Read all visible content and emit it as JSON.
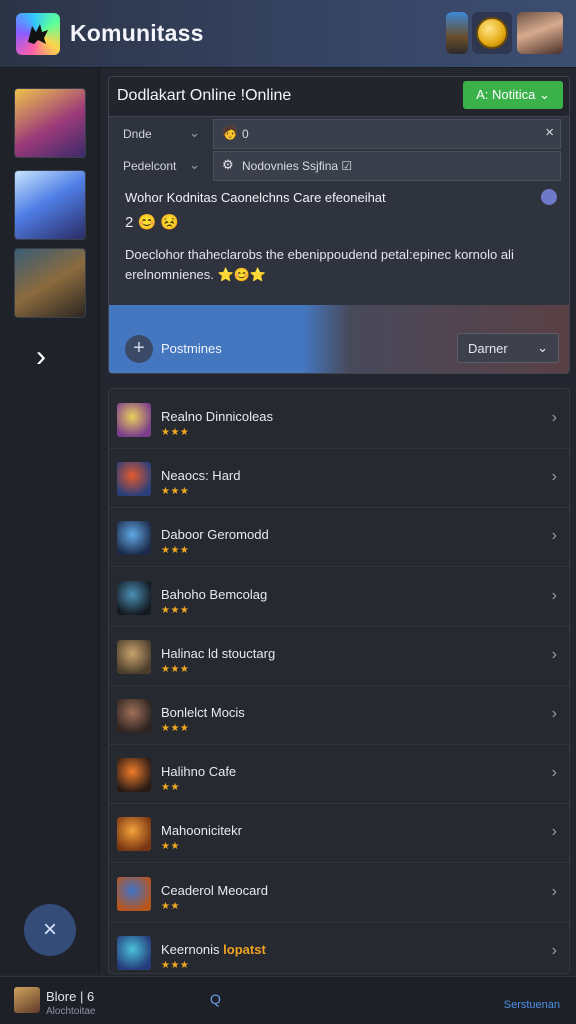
{
  "app": {
    "title": "Komunitass"
  },
  "topbar": {
    "icons": [
      "character-icon",
      "coin-icon",
      "avatar-icon"
    ]
  },
  "sidebar": {
    "thumbnails": [
      "game-thumbnail-1",
      "game-thumbnail-2",
      "game-thumbnail-3"
    ],
    "next_symbol": "›",
    "close_symbol": "×"
  },
  "card": {
    "title": "Dodlakart Online !Online",
    "action_button": "A: Notitica ⌄",
    "row1": {
      "label": "Dnde",
      "chevron": "⌄",
      "value": "0",
      "icon": "🧑",
      "clear": "×"
    },
    "row2": {
      "label": "Pedelcont",
      "chevron": "⌄",
      "value": "Nodovnies Ssjfina ☑",
      "icon": "⚙"
    },
    "line1": "Wohor Kodnitas Caonelchns Care efeoneihat",
    "emoji1": "2 😊 😣",
    "body": "Doeclohor thaheclarobs the ebenippoudend petal:epinec kornolo ali erelnomnienes. ⭐😊⭐",
    "footer": {
      "plus_symbol": "+",
      "label": "Postmines",
      "select_value": "Darner",
      "select_chevron": "⌄"
    }
  },
  "list": {
    "items": [
      {
        "name": "Realno Dinnicoleas",
        "stars": "★★★",
        "chevron": "›",
        "color1": "#e9cf5c",
        "color2": "#7a3d8c"
      },
      {
        "name": "Neaocs: Hard",
        "stars": "★★★",
        "chevron": "›",
        "color1": "#e2592e",
        "color2": "#2a3f7a"
      },
      {
        "name": "Daboor Geromodd",
        "stars": "★★★",
        "chevron": "›",
        "color1": "#5fa9e6",
        "color2": "#1d2b4a"
      },
      {
        "name": "Bahoho Bemcolag",
        "stars": "★★★",
        "chevron": "›",
        "color1": "#4b8fb3",
        "color2": "#141a22"
      },
      {
        "name": "Halinac ld stouctarg",
        "stars": "★★★",
        "chevron": "›",
        "color1": "#c9a36e",
        "color2": "#4a3d2c"
      },
      {
        "name": "Bonlelct Mocis",
        "stars": "★★★",
        "chevron": "›",
        "color1": "#a1705a",
        "color2": "#2d2421"
      },
      {
        "name": "Halihno Cafe",
        "stars": "★★",
        "chevron": "›",
        "color1": "#f07b2b",
        "color2": "#2a1c15"
      },
      {
        "name": "Mahoonicitekr",
        "stars": "★★",
        "chevron": "›",
        "color1": "#f3a23a",
        "color2": "#7a3614"
      },
      {
        "name": "Ceaderol Meocard",
        "stars": "★★",
        "chevron": "›",
        "color1": "#3e73c8",
        "color2": "#b8561e"
      },
      {
        "name": "Keernonis",
        "highlight": "lopatst",
        "stars": "★★★",
        "chevron": "›",
        "color1": "#49c2d9",
        "color2": "#253a7a"
      }
    ]
  },
  "bottombar": {
    "label": "Blore | 6",
    "sub": "Alochtoitae",
    "search_icon": "Q",
    "link": "Serstuenan"
  }
}
